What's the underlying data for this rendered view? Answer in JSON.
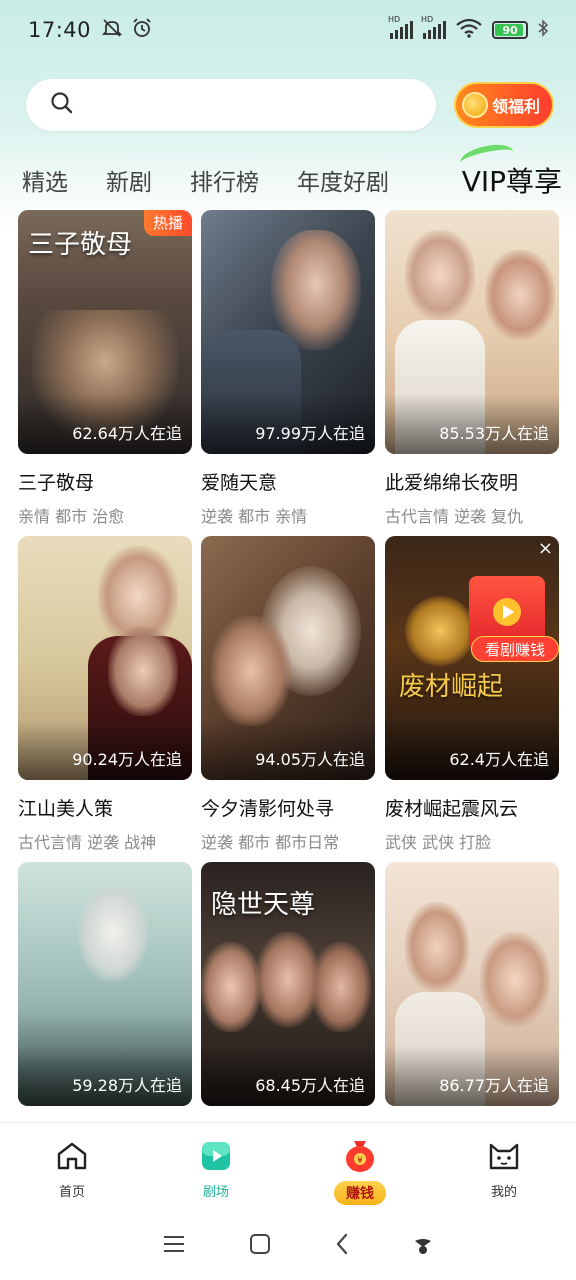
{
  "status_bar": {
    "time": "17:40",
    "battery": "90",
    "icons": [
      "mute-icon",
      "alarm-icon",
      "signal-hd-icon",
      "signal-hd-icon",
      "wifi-icon",
      "battery-icon",
      "bluetooth-icon"
    ]
  },
  "search": {
    "placeholder": "",
    "welfare_label": "领福利"
  },
  "tabs": [
    {
      "label": "精选"
    },
    {
      "label": "新剧"
    },
    {
      "label": "排行榜"
    },
    {
      "label": "年度好剧"
    },
    {
      "label": "VIP尊享"
    }
  ],
  "dramas": [
    {
      "title": "三子敬母",
      "tags": "亲情 都市 治愈",
      "followers": "62.64万人在追",
      "badge": "热播",
      "poster_text": "三子敬母"
    },
    {
      "title": "爱随天意",
      "tags": "逆袭 都市 亲情",
      "followers": "97.99万人在追"
    },
    {
      "title": "此爱绵绵长夜明",
      "tags": "古代言情 逆袭 复仇",
      "followers": "85.53万人在追"
    },
    {
      "title": "江山美人策",
      "tags": "古代言情 逆袭 战神",
      "followers": "90.24万人在追"
    },
    {
      "title": "今夕清影何处寻",
      "tags": "逆袭 都市 都市日常",
      "followers": "94.05万人在追"
    },
    {
      "title": "废材崛起震风云",
      "tags": "武侠 武侠 打脸",
      "followers": "62.4万人在追",
      "overlay_label": "看剧赚钱",
      "poster_text": "废材崛起"
    },
    {
      "title": "",
      "tags": "",
      "followers": "59.28万人在追"
    },
    {
      "title": "",
      "tags": "",
      "followers": "68.45万人在追",
      "poster_text": "隐世天尊"
    },
    {
      "title": "",
      "tags": "",
      "followers": "86.77万人在追"
    }
  ],
  "bottom_nav": [
    {
      "label": "首页",
      "icon": "home-icon"
    },
    {
      "label": "剧场",
      "icon": "theater-icon",
      "active": true
    },
    {
      "label": "赚钱",
      "icon": "money-bag-icon"
    },
    {
      "label": "我的",
      "icon": "cat-face-icon"
    }
  ],
  "colors": {
    "accent": "#1bb396",
    "header_bg": "#c9ece6",
    "welfare_bg": "#ff5a26",
    "badge_bg": "#ff5a2b"
  }
}
